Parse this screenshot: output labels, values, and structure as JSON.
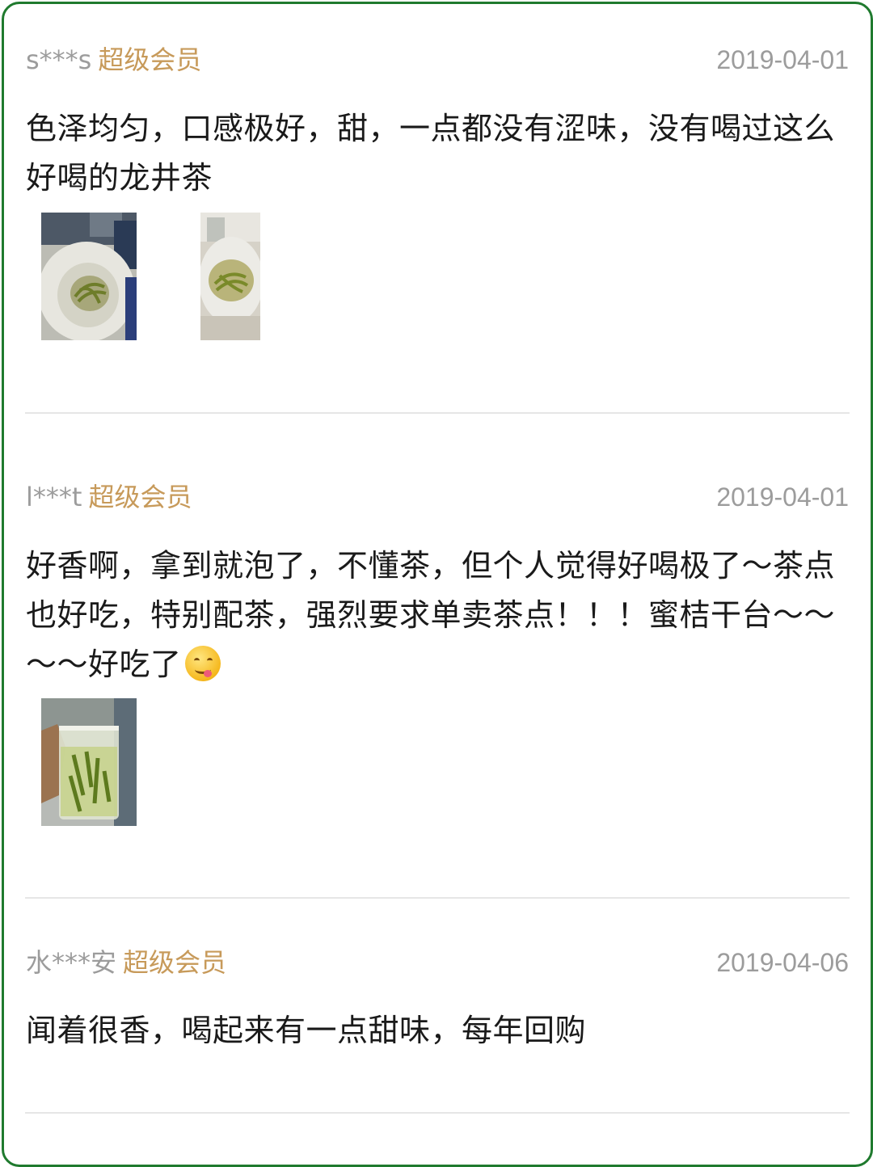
{
  "reviews": [
    {
      "username": "s***s",
      "badge": "超级会员",
      "date": "2019-04-01",
      "content": "色泽均匀，口感极好，甜，一点都没有涩味，没有喝过这么好喝的龙井茶",
      "photos": [
        "tea-cup-photo",
        "tea-cup-photo"
      ]
    },
    {
      "username": "l***t",
      "badge": "超级会员",
      "date": "2019-04-01",
      "content": "好香啊，拿到就泡了，不懂茶，但个人觉得好喝极了～茶点也好吃，特别配茶，强烈要求单卖茶点！！！蜜桔干台～～～～好吃了",
      "emoji": "yum-face-emoji",
      "photos": [
        "glass-tea-photo"
      ]
    },
    {
      "username": "水***安",
      "badge": "超级会员",
      "date": "2019-04-06",
      "content": "闻着很香，喝起来有一点甜味，每年回购"
    }
  ]
}
